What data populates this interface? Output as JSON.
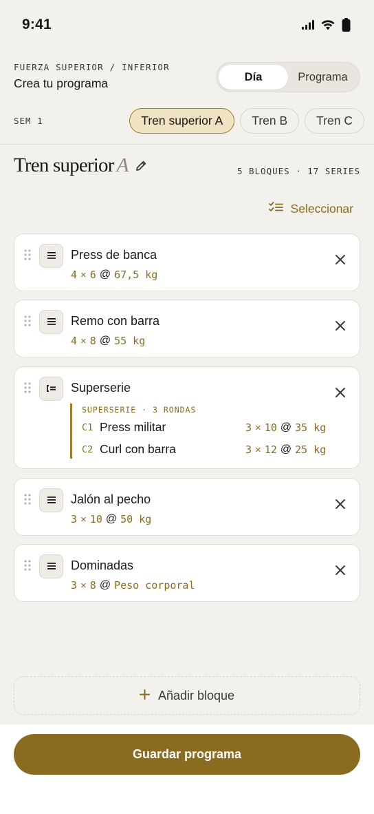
{
  "status_bar": {
    "time": "9:41"
  },
  "header": {
    "eyebrow": "FUERZA SUPERIOR / INFERIOR",
    "subtitle": "Crea tu programa",
    "segments": [
      {
        "label": "Día",
        "active": true
      },
      {
        "label": "Programa",
        "active": false
      }
    ]
  },
  "week": {
    "label": "SEM 1",
    "days": [
      {
        "label": "Tren superior A",
        "active": true
      },
      {
        "label": "Tren B",
        "active": false
      },
      {
        "label": "Tren C",
        "active": false
      }
    ]
  },
  "day": {
    "title": "Tren superior",
    "title_letter": "A",
    "stats": "5 BLOQUES · 17 SERIES",
    "select_label": "Seleccionar"
  },
  "blocks": [
    {
      "name": "Press de banca",
      "sets": "4",
      "reps": "6",
      "weight": "67,5 kg"
    },
    {
      "name": "Remo con barra",
      "sets": "4",
      "reps": "8",
      "weight": "55 kg"
    },
    {
      "name": "Superserie",
      "caption": "SUPERSERIE · 3 RONDAS",
      "items": [
        {
          "code": "C1",
          "name": "Press militar",
          "sets": "3",
          "reps": "10",
          "weight": "35 kg"
        },
        {
          "code": "C2",
          "name": "Curl con barra",
          "sets": "3",
          "reps": "12",
          "weight": "25 kg"
        }
      ]
    },
    {
      "name": "Jalón al pecho",
      "sets": "3",
      "reps": "10",
      "weight": "50 kg"
    },
    {
      "name": "Dominadas",
      "sets": "3",
      "reps": "8",
      "weight": "Peso corporal"
    }
  ],
  "symbols": {
    "times": "×",
    "at": "@",
    "plus": "+"
  },
  "add_block_label": "Añadir bloque",
  "save_label": "Guardar programa",
  "colors": {
    "accent": "#8a6b1f",
    "accent_light": "#efe3c3",
    "background": "#f3f1ec"
  }
}
